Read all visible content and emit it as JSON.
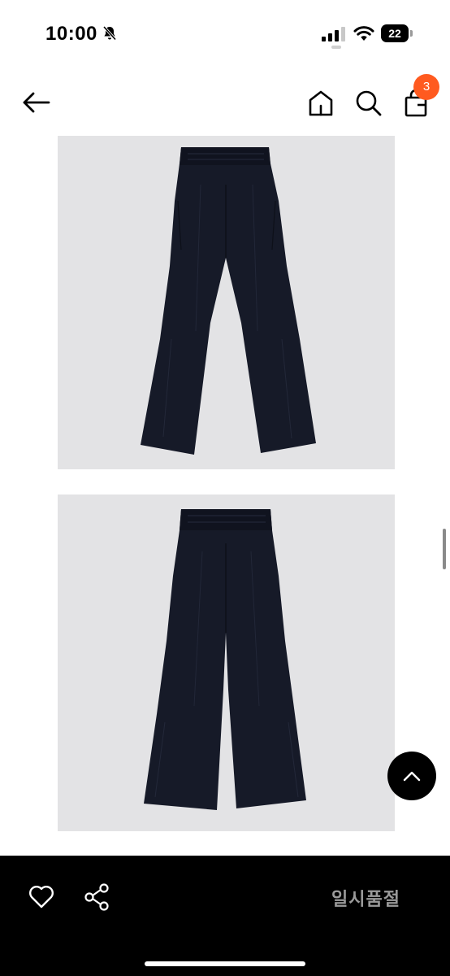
{
  "status_bar": {
    "time": "10:00",
    "battery_level": "22",
    "icons": [
      "bell-slash-icon",
      "cellular-signal-icon",
      "wifi-icon",
      "battery-icon"
    ]
  },
  "header": {
    "cart_count": "3",
    "icons": [
      "back-arrow-icon",
      "home-icon",
      "search-icon",
      "shopping-bag-icon"
    ]
  },
  "product_images": [
    {
      "view": "front",
      "garment_color": "#141826"
    },
    {
      "view": "back",
      "garment_color": "#141826"
    }
  ],
  "colors": {
    "image_background": "#e3e3e5",
    "badge": "#ff5a1f",
    "bottom_bar": "#000000",
    "soldout_text": "#9a9a9a"
  },
  "bottom_bar": {
    "soldout_label": "일시품절",
    "icons": [
      "heart-icon",
      "share-icon"
    ]
  },
  "scroll_top_icon": "chevron-up-icon"
}
